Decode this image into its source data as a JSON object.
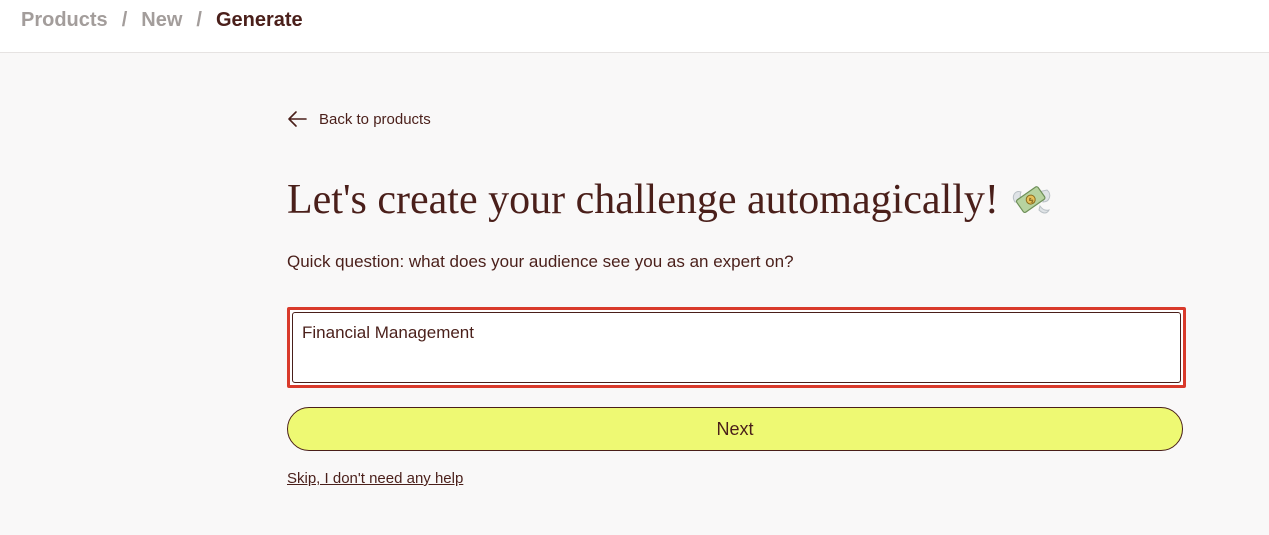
{
  "breadcrumb": {
    "items": [
      "Products",
      "New",
      "Generate"
    ],
    "separator": "/"
  },
  "back_link": {
    "label": "Back to products",
    "icon": "arrow-left-icon"
  },
  "headline": {
    "text": "Let's create your challenge automagically!",
    "icon": "money-with-wings-icon"
  },
  "question": {
    "text": "Quick question: what does your audience see you as an expert on?"
  },
  "expertise_input": {
    "value": "Financial Management"
  },
  "next_button": {
    "label": "Next"
  },
  "skip_link": {
    "label": "Skip, I don't need any help"
  },
  "colors": {
    "text": "#4a1f1a",
    "muted": "#a39d9b",
    "accent_button": "#eef973",
    "focus_outline": "#d93a2b",
    "background": "#f9f8f8"
  }
}
